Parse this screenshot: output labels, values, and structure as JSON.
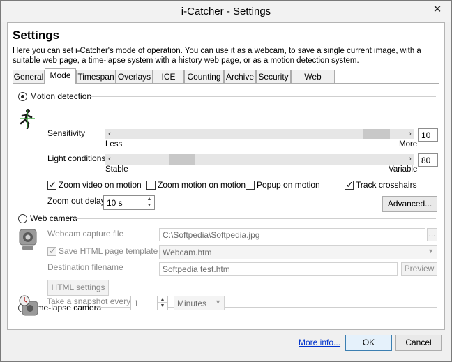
{
  "window": {
    "title": "i-Catcher - Settings",
    "close_glyph": "✕"
  },
  "header": {
    "title": "Settings",
    "description": "Here you can set i-Catcher's mode of operation. You can use it as a webcam, to save a single current image, with a suitable web page, a time-lapse system with a history web page, or as a motion detection system."
  },
  "tabs": [
    "General",
    "Mode",
    "Timespan",
    "Overlays",
    "ICE",
    "Counting",
    "Archive",
    "Security",
    "Web server"
  ],
  "active_tab": "Mode",
  "motion": {
    "radio_label": "Motion detection",
    "selected": true,
    "icon": "running-figure-icon",
    "sensitivity": {
      "label": "Sensitivity",
      "value": "10",
      "min_label": "Less",
      "max_label": "More",
      "level": 0.92
    },
    "light": {
      "label": "Light conditions",
      "value": "80",
      "min_label": "Stable",
      "max_label": "Variable",
      "level": 0.25
    },
    "checkboxes": [
      {
        "label": "Zoom video on motion",
        "checked": true
      },
      {
        "label": "Zoom motion on motion",
        "checked": false
      },
      {
        "label": "Popup on motion",
        "checked": false
      },
      {
        "label": "Track crosshairs",
        "checked": true
      }
    ],
    "zoom_out_delay": {
      "label": "Zoom out delay",
      "value": "10 s"
    },
    "advanced_label": "Advanced..."
  },
  "webcam": {
    "radio_label": "Web camera",
    "selected": false,
    "icon": "webcam-icon",
    "capture_file": {
      "label": "Webcam capture file",
      "value": "C:\\Softpedia\\Softpedia.jpg",
      "browse": "..."
    },
    "save_template": {
      "label": "Save HTML page template",
      "checked": true,
      "value": "Webcam.htm"
    },
    "destination": {
      "label": "Destination filename",
      "value": "Softpedia test.htm",
      "preview": "Preview"
    },
    "html_settings_label": "HTML settings"
  },
  "timelapse": {
    "radio_label": "Time-lapse camera",
    "selected": false,
    "icon": "timer-camera-icon",
    "snapshot": {
      "label": "Take a snapshot every",
      "value": "1",
      "unit": "Minutes"
    }
  },
  "footer": {
    "more_info": "More info...",
    "ok": "OK",
    "cancel": "Cancel"
  }
}
